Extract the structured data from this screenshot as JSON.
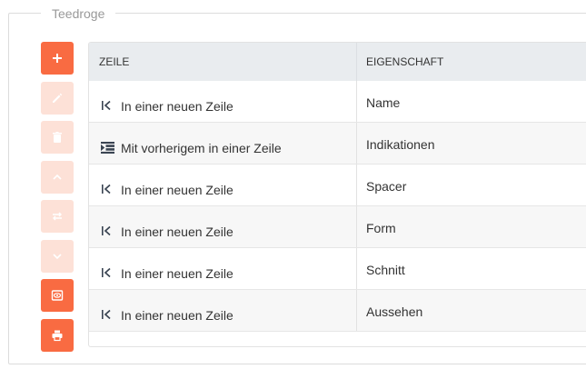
{
  "fieldset": {
    "legend": "Teedroge"
  },
  "toolbar": {
    "buttons": [
      {
        "name": "add-button",
        "icon": "plus-icon",
        "state": "active"
      },
      {
        "name": "edit-button",
        "icon": "pencil-icon",
        "state": "disabled"
      },
      {
        "name": "delete-button",
        "icon": "trash-icon",
        "state": "disabled"
      },
      {
        "name": "move-up-button",
        "icon": "chevron-up-icon",
        "state": "disabled"
      },
      {
        "name": "swap-button",
        "icon": "swap-icon",
        "state": "disabled"
      },
      {
        "name": "move-down-button",
        "icon": "chevron-down-icon",
        "state": "disabled"
      },
      {
        "name": "preview-button",
        "icon": "preview-icon",
        "state": "active"
      },
      {
        "name": "print-button",
        "icon": "print-icon",
        "state": "active"
      }
    ],
    "colors": {
      "active": "#f96b42",
      "disabled": "#fde1d7"
    }
  },
  "table": {
    "headers": [
      "Zeile",
      "Eigenschaft"
    ],
    "rows": [
      {
        "zeile": "In einer neuen Zeile",
        "icon": "new-line-icon",
        "eigenschaft": "Name"
      },
      {
        "zeile": "Mit vorherigem in einer Zeile",
        "icon": "indent-icon",
        "eigenschaft": "Indikationen"
      },
      {
        "zeile": "In einer neuen Zeile",
        "icon": "new-line-icon",
        "eigenschaft": "Spacer"
      },
      {
        "zeile": "In einer neuen Zeile",
        "icon": "new-line-icon",
        "eigenschaft": "Form"
      },
      {
        "zeile": "In einer neuen Zeile",
        "icon": "new-line-icon",
        "eigenschaft": "Schnitt"
      },
      {
        "zeile": "In einer neuen Zeile",
        "icon": "new-line-icon",
        "eigenschaft": "Aussehen"
      }
    ]
  }
}
